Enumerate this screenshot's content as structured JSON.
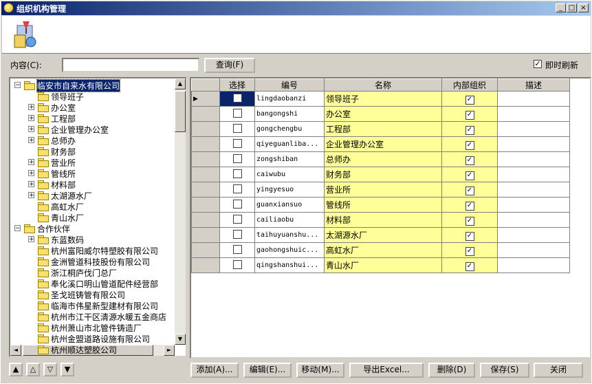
{
  "window": {
    "title": "组织机构管理",
    "min": "_",
    "max": "□",
    "close": "×"
  },
  "search": {
    "label": "内容(C):",
    "value": "",
    "query_button": "查询(F)",
    "instant_refresh_label": "即时刷新",
    "instant_refresh_checked": true
  },
  "tree": {
    "nodes": [
      {
        "label": "临安市自来水有限公司",
        "level": 0,
        "expander": "−",
        "selected": true
      },
      {
        "label": "领导班子",
        "level": 1,
        "expander": ""
      },
      {
        "label": "办公室",
        "level": 1,
        "expander": "+"
      },
      {
        "label": "工程部",
        "level": 1,
        "expander": "+"
      },
      {
        "label": "企业管理办公室",
        "level": 1,
        "expander": "+"
      },
      {
        "label": "总师办",
        "level": 1,
        "expander": "+"
      },
      {
        "label": "财务部",
        "level": 1,
        "expander": ""
      },
      {
        "label": "营业所",
        "level": 1,
        "expander": "+"
      },
      {
        "label": "管线所",
        "level": 1,
        "expander": "+"
      },
      {
        "label": "材料部",
        "level": 1,
        "expander": "+"
      },
      {
        "label": "太湖源水厂",
        "level": 1,
        "expander": "+"
      },
      {
        "label": "高虹水厂",
        "level": 1,
        "expander": ""
      },
      {
        "label": "青山水厂",
        "level": 1,
        "expander": ""
      },
      {
        "label": "合作伙伴",
        "level": 0,
        "expander": "−"
      },
      {
        "label": "东蓝数码",
        "level": 1,
        "expander": "+"
      },
      {
        "label": "杭州富阳威尔特塑胶有限公司",
        "level": 1,
        "expander": ""
      },
      {
        "label": "金洲管道科技股份有限公司",
        "level": 1,
        "expander": ""
      },
      {
        "label": "浙江桐庐伐门总厂",
        "level": 1,
        "expander": ""
      },
      {
        "label": "奉化溪口明山管道配件经营部",
        "level": 1,
        "expander": ""
      },
      {
        "label": "圣戈班铸管有限公司",
        "level": 1,
        "expander": ""
      },
      {
        "label": "临海市伟星新型建材有限公司",
        "level": 1,
        "expander": ""
      },
      {
        "label": "杭州市江干区清源水暖五金商店",
        "level": 1,
        "expander": ""
      },
      {
        "label": "杭州萧山市北管件铸造厂",
        "level": 1,
        "expander": ""
      },
      {
        "label": "杭州金盟道路设施有限公司",
        "level": 1,
        "expander": ""
      },
      {
        "label": "杭州顺达塑胶公司",
        "level": 1,
        "expander": ""
      }
    ]
  },
  "grid": {
    "columns": [
      "选择",
      "编号",
      "名称",
      "内部组织",
      "描述"
    ],
    "rows": [
      {
        "code": "lingdaobanzi",
        "name": "领导班子",
        "internal": true,
        "desc": "",
        "current": true
      },
      {
        "code": "bangongshi",
        "name": "办公室",
        "internal": true,
        "desc": ""
      },
      {
        "code": "gongchengbu",
        "name": "工程部",
        "internal": true,
        "desc": ""
      },
      {
        "code": "qiyeguanliba...",
        "name": "企业管理办公室",
        "internal": true,
        "desc": ""
      },
      {
        "code": "zongshiban",
        "name": "总师办",
        "internal": true,
        "desc": ""
      },
      {
        "code": "caiwubu",
        "name": "财务部",
        "internal": true,
        "desc": ""
      },
      {
        "code": "yingyesuo",
        "name": "营业所",
        "internal": true,
        "desc": ""
      },
      {
        "code": "guanxiansuo",
        "name": "管线所",
        "internal": true,
        "desc": ""
      },
      {
        "code": "cailiaobu",
        "name": "材料部",
        "internal": true,
        "desc": ""
      },
      {
        "code": "taihuyuanshu...",
        "name": "太湖源水厂",
        "internal": true,
        "desc": ""
      },
      {
        "code": "gaohongshuic...",
        "name": "高虹水厂",
        "internal": true,
        "desc": ""
      },
      {
        "code": "qingshanshui...",
        "name": "青山水厂",
        "internal": true,
        "desc": ""
      }
    ]
  },
  "toolbar": {
    "move_up_top": "▲",
    "move_up": "△",
    "move_down": "▽",
    "move_down_bottom": "▼",
    "add": "添加(A)...",
    "edit": "编辑(E)...",
    "move": "移动(M)...",
    "export": "导出Excel...",
    "delete": "删除(D)",
    "save": "保存(S)",
    "close": "关闭"
  },
  "colors": {
    "titlebar_start": "#0a246a",
    "titlebar_end": "#a6caf0",
    "name_cell_bg": "#ffff99",
    "selection": "#0a246a"
  }
}
